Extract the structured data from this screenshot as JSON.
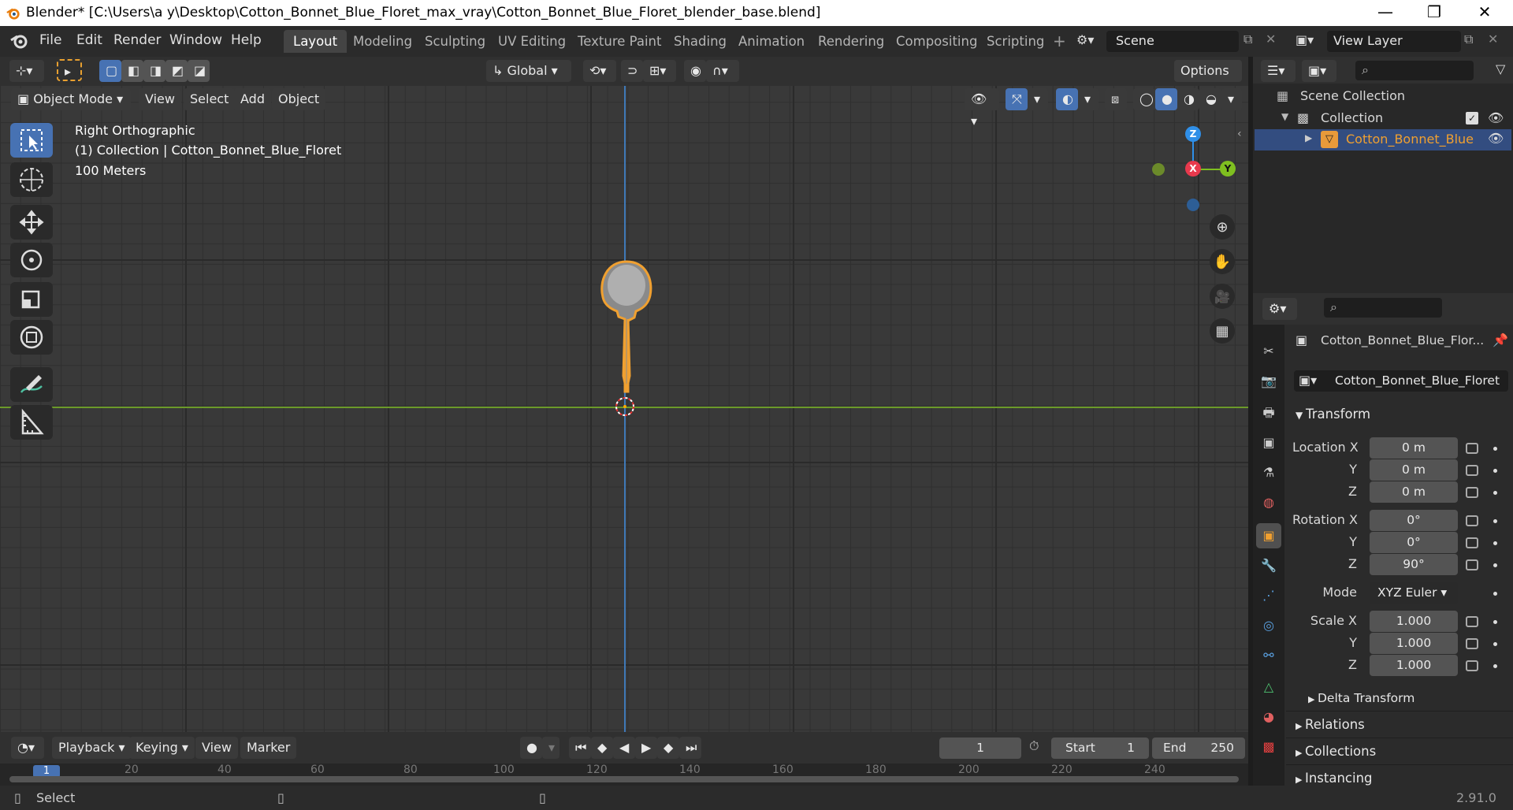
{
  "window": {
    "title": "Blender* [C:\\Users\\a y\\Desktop\\Cotton_Bonnet_Blue_Floret_max_vray\\Cotton_Bonnet_Blue_Floret_blender_base.blend]",
    "minimize": "—",
    "maximize": "❐",
    "close": "✕"
  },
  "menu": [
    "File",
    "Edit",
    "Render",
    "Window",
    "Help"
  ],
  "workspaces": [
    "Layout",
    "Modeling",
    "Sculpting",
    "UV Editing",
    "Texture Paint",
    "Shading",
    "Animation",
    "Rendering",
    "Compositing",
    "Scripting"
  ],
  "workspace_add": "+",
  "scene": {
    "label": "Scene"
  },
  "view_layer": {
    "label": "View Layer"
  },
  "header": {
    "transform_orientation": "Global",
    "options": "Options",
    "mode": "Object Mode",
    "view_menu": [
      "View",
      "Select",
      "Add",
      "Object"
    ]
  },
  "viewport": {
    "view_name": "Right Orthographic",
    "collection_line": "(1) Collection | Cotton_Bonnet_Blue_Floret",
    "scale": "100 Meters",
    "gizmo": {
      "x": "X",
      "y": "Y",
      "z": "Z"
    }
  },
  "outliner": {
    "scene_collection": "Scene Collection",
    "collection": "Collection",
    "object": "Cotton_Bonnet_Blue"
  },
  "properties": {
    "object_name_header": "Cotton_Bonnet_Blue_Flor...",
    "object_name_field": "Cotton_Bonnet_Blue_Floret",
    "transform": "Transform",
    "location": {
      "label": "Location X",
      "x": "0 m",
      "y": "0 m",
      "z": "0 m"
    },
    "rotation": {
      "label": "Rotation X",
      "x": "0°",
      "y": "0°",
      "z": "90°"
    },
    "axis_y": "Y",
    "axis_z": "Z",
    "mode_label": "Mode",
    "mode_value": "XYZ Euler",
    "scale": {
      "label": "Scale X",
      "x": "1.000",
      "y": "1.000",
      "z": "1.000"
    },
    "delta_transform": "Delta Transform",
    "relations": "Relations",
    "collections": "Collections",
    "instancing": "Instancing"
  },
  "timeline": {
    "menus": [
      "Playback",
      "Keying",
      "View",
      "Marker"
    ],
    "current_frame": "1",
    "start_label": "Start",
    "start_value": "1",
    "end_label": "End",
    "end_value": "250",
    "ruler": [
      "1",
      "20",
      "40",
      "60",
      "80",
      "100",
      "120",
      "140",
      "160",
      "180",
      "200",
      "220",
      "240"
    ]
  },
  "statusbar": {
    "select": "Select",
    "version": "2.91.0"
  },
  "colors": {
    "accent_blue": "#4772b3",
    "selection_orange": "#f0a030",
    "axis_x": "#e8394d",
    "axis_y": "#7fbf20",
    "axis_z": "#2f8fe8"
  }
}
